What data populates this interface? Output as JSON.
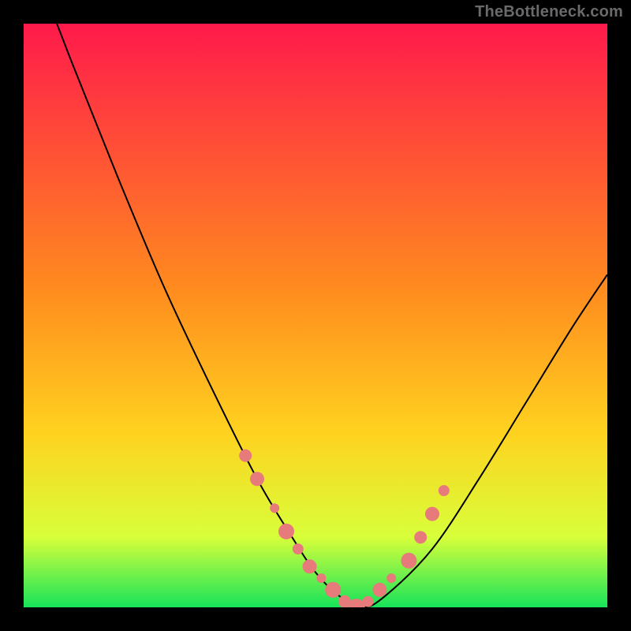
{
  "watermark": "TheBottleneck.com",
  "colors": {
    "background": "#000000",
    "gradient_top": "#ff1a4b",
    "gradient_mid": "#ffd21f",
    "gradient_bottom": "#17e35a",
    "curve": "#000000",
    "marker_fill": "#e77a7a",
    "marker_stroke": "#d46161",
    "watermark": "#6a6a6a"
  },
  "chart_data": {
    "type": "line",
    "title": "",
    "xlabel": "",
    "ylabel": "",
    "xlim": [
      0,
      100
    ],
    "ylim": [
      0,
      100
    ],
    "grid": false,
    "legend": false,
    "series": [
      {
        "name": "bottleneck-curve",
        "x": [
          0,
          8,
          16,
          24,
          32,
          40,
          46,
          50,
          54,
          58,
          62,
          70,
          78,
          86,
          94,
          100
        ],
        "y": [
          115,
          94,
          74,
          55,
          38,
          22,
          12,
          6,
          2,
          0,
          2,
          10,
          22,
          35,
          48,
          57
        ]
      }
    ],
    "markers": {
      "name": "highlight-band",
      "x": [
        38,
        40,
        43,
        45,
        47,
        49,
        51,
        53,
        55,
        57,
        59,
        61,
        63,
        66,
        68,
        70,
        72
      ],
      "y": [
        26,
        22,
        17,
        13,
        10,
        7,
        5,
        3,
        1,
        0,
        1,
        3,
        5,
        8,
        12,
        16,
        20
      ],
      "size": [
        8,
        9,
        6,
        10,
        7,
        9,
        6,
        10,
        8,
        11,
        7,
        9,
        6,
        10,
        8,
        9,
        7
      ]
    }
  }
}
